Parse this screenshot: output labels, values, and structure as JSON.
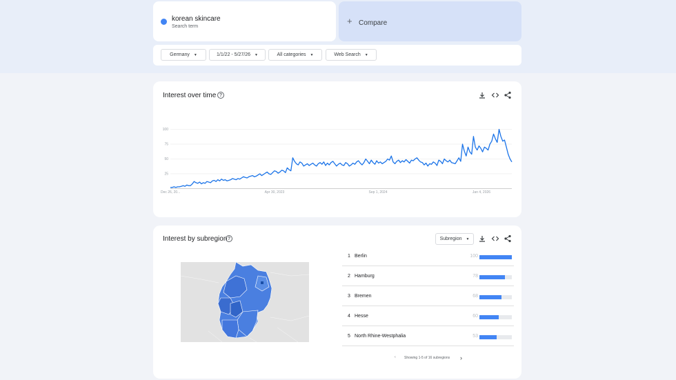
{
  "search": {
    "term": "korean skincare",
    "term_subtitle": "Search term",
    "term_color": "#4285f4",
    "compare_label": "Compare",
    "compare_icon": "plus-icon"
  },
  "filters": {
    "region": "Germany",
    "date_range": "1/1/22 - 5/27/26",
    "category": "All categories",
    "search_type": "Web Search"
  },
  "interest_over_time": {
    "title": "Interest over time",
    "icons": [
      "help-icon",
      "download-icon",
      "embed-code-icon",
      "share-icon"
    ]
  },
  "chart_data": {
    "type": "line",
    "title": "",
    "xlabel": "",
    "ylabel": "",
    "ylim": [
      0,
      100
    ],
    "y_ticks": [
      "100",
      "75",
      "50",
      "25"
    ],
    "x_tick_labels": [
      "Dec 26, 20...",
      "Apr 30, 2023",
      "Sep 1, 2024",
      "Jan 4, 2026"
    ],
    "grid": true,
    "line_color": "#1a73e8",
    "series": [
      {
        "name": "",
        "values": [
          2,
          2,
          3,
          2,
          3,
          3,
          4,
          5,
          4,
          6,
          5,
          5,
          8,
          12,
          10,
          9,
          11,
          8,
          10,
          9,
          12,
          11,
          10,
          13,
          14,
          12,
          15,
          13,
          16,
          14,
          15,
          13,
          14,
          15,
          17,
          16,
          15,
          17,
          16,
          18,
          20,
          19,
          18,
          20,
          21,
          22,
          20,
          21,
          23,
          25,
          22,
          24,
          26,
          28,
          25,
          24,
          27,
          30,
          29,
          26,
          28,
          31,
          30,
          27,
          35,
          32,
          30,
          52,
          46,
          42,
          40,
          45,
          43,
          38,
          40,
          42,
          39,
          41,
          43,
          40,
          38,
          42,
          44,
          41,
          45,
          39,
          43,
          40,
          44,
          46,
          42,
          38,
          41,
          43,
          40,
          39,
          44,
          42,
          38,
          40,
          43,
          41,
          45,
          47,
          43,
          40,
          44,
          50,
          46,
          42,
          48,
          44,
          41,
          47,
          43,
          45,
          42,
          44,
          46,
          50,
          48,
          55,
          45,
          42,
          46,
          48,
          44,
          47,
          45,
          49,
          46,
          43,
          48,
          47,
          50,
          52,
          48,
          45,
          44,
          40,
          43,
          38,
          42,
          41,
          45,
          43,
          39,
          48,
          46,
          42,
          50,
          47,
          45,
          48,
          44,
          43,
          42,
          47,
          52,
          46,
          75,
          63,
          55,
          70,
          62,
          58,
          88,
          70,
          65,
          72,
          68,
          62,
          70,
          68,
          65,
          75,
          80,
          92,
          84,
          78,
          100,
          88,
          80,
          82,
          70,
          58,
          50,
          45
        ]
      }
    ]
  },
  "interest_by_subregion": {
    "title": "Interest by subregion",
    "dropdown": "Subregion",
    "rows": [
      {
        "rank": "1",
        "name": "Berlin",
        "value": "100",
        "level": 100
      },
      {
        "rank": "2",
        "name": "Hamburg",
        "value": "78",
        "level": 78
      },
      {
        "rank": "3",
        "name": "Bremen",
        "value": "68",
        "level": 68
      },
      {
        "rank": "4",
        "name": "Hesse",
        "value": "60",
        "level": 60
      },
      {
        "rank": "5",
        "name": "North Rhine-Westphalia",
        "value": "53",
        "level": 53
      }
    ],
    "pager_text": "Showing 1-5 of 16 subregions",
    "bar_color": "#4285f4",
    "map_fill_color": "#4a7fe0",
    "map_background": "#e2e2e2"
  }
}
